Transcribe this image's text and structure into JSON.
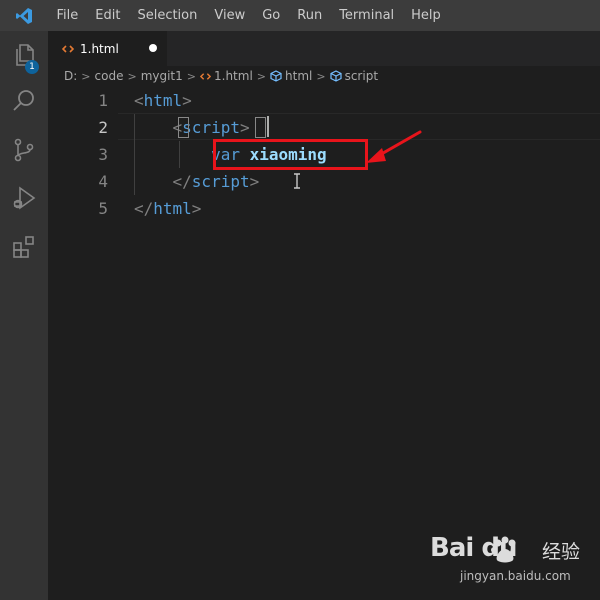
{
  "menu": {
    "items": [
      "File",
      "Edit",
      "Selection",
      "View",
      "Go",
      "Run",
      "Terminal",
      "Help"
    ]
  },
  "activity_bar": {
    "icons": [
      "files-icon",
      "search-icon",
      "source-control-icon",
      "run-debug-icon",
      "extensions-icon"
    ],
    "explorer_badge": "1"
  },
  "tab": {
    "label": "1.html",
    "icon": "html-file-icon",
    "dirty": true
  },
  "breadcrumb": {
    "items": [
      "D:",
      "code",
      "mygit1",
      "1.html",
      "html",
      "script"
    ]
  },
  "editor": {
    "lines": [
      {
        "number": "1",
        "indent": "",
        "open": "<",
        "tag": "html",
        "close": ">"
      },
      {
        "number": "2",
        "indent": "    ",
        "open": "<",
        "tag": "script",
        "close": ">"
      },
      {
        "number": "3",
        "indent": "        ",
        "keyword": "var",
        "identifier": "xiaoming"
      },
      {
        "number": "4",
        "indent": "    ",
        "open": "</",
        "tag": "script",
        "close": ">"
      },
      {
        "number": "5",
        "indent": "",
        "open": "</",
        "tag": "html",
        "close": ">"
      }
    ],
    "active_line": "2"
  },
  "colors": {
    "background": "#1e1e1e",
    "tag": "#569cd6",
    "identifier": "#9cdcfe",
    "annotation": "#e8141b"
  },
  "watermark": {
    "brand": "Bai du",
    "product": "经验",
    "url": "jingyan.baidu.com"
  }
}
